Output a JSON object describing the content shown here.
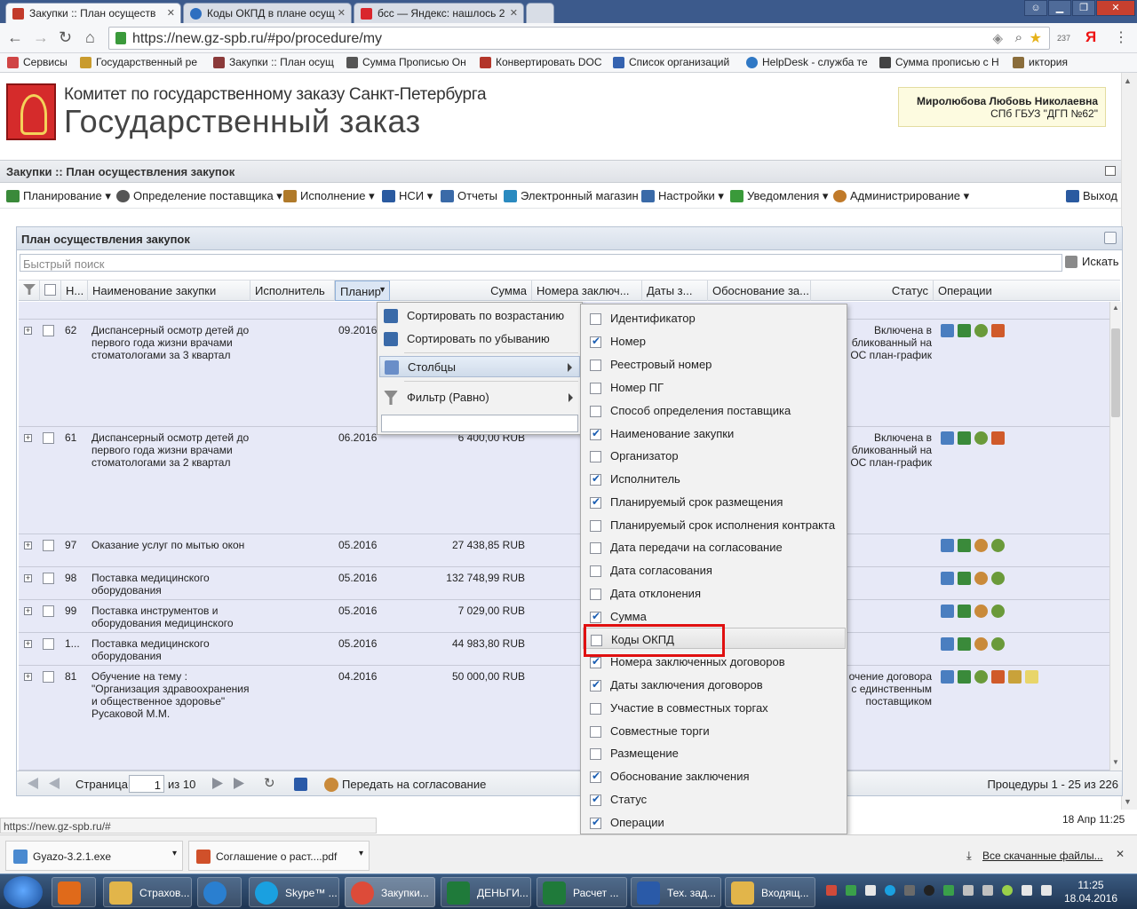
{
  "browser": {
    "tabs": [
      {
        "label": "Закупки :: План осуществ",
        "color": "#c23a2a"
      },
      {
        "label": "Коды ОКПД в плане осущ",
        "color": "#2e6fc0"
      },
      {
        "label": "бсс — Яндекс: нашлось 2",
        "color": "#d9262c"
      }
    ],
    "url": "https://new.gz-spb.ru/#po/procedure/my",
    "badge": "237",
    "bookmarks": [
      {
        "label": "Сервисы",
        "color": "#d04545"
      },
      {
        "label": "Государственный ре",
        "color": "#c99b2d"
      },
      {
        "label": "Закупки :: План осущ",
        "color": "#8b3a3a"
      },
      {
        "label": "Сумма Прописью Он",
        "color": "#555555"
      },
      {
        "label": "Конвертировать DOC",
        "color": "#b3362a"
      },
      {
        "label": "Список организаций",
        "color": "#3563b0"
      },
      {
        "label": "HelpDesk - служба те",
        "color": "#2f78c5"
      },
      {
        "label": "Сумма прописью с Н",
        "color": "#444444"
      },
      {
        "label": "иктория",
        "color": "#8a6d3b"
      }
    ],
    "status_url": "https://new.gz-spb.ru/#",
    "time_inpage": "18 Апр 11:25"
  },
  "site": {
    "subtitle": "Комитет по государственному заказу Санкт-Петербурга",
    "title": "Государственный заказ",
    "user_name": "Миролюбова Любовь Николаевна",
    "user_org": "СПб ГБУЗ \"ДГП №62\""
  },
  "app": {
    "title": "Закупки :: План осуществления закупок",
    "menu": [
      {
        "label": "Планирование",
        "color": "#3a8a3a"
      },
      {
        "label": "Определение поставщика",
        "color": "#555555"
      },
      {
        "label": "Исполнение",
        "color": "#b07a2a"
      },
      {
        "label": "НСИ",
        "color": "#2a5aa0"
      },
      {
        "label": "Отчеты",
        "color": "#3a6aa8"
      },
      {
        "label": "Электронный магазин",
        "color": "#2a8ac0"
      },
      {
        "label": "Настройки",
        "color": "#3a6aa8"
      },
      {
        "label": "Уведомления",
        "color": "#3a9a3a"
      },
      {
        "label": "Администрирование",
        "color": "#c07a2a"
      }
    ],
    "logout": "Выход"
  },
  "panel": {
    "title": "План осуществления закупок",
    "search_placeholder": "Быстрый поиск",
    "search_button": "Искать",
    "columns": {
      "num": "Н...",
      "name": "Наименование закупки",
      "executor": "Исполнитель",
      "plan": "Планир",
      "sum": "Сумма",
      "contracts": "Номера заключ...",
      "dates": "Даты з...",
      "justification": "Обоснование за...",
      "status": "Статус",
      "ops": "Операции"
    },
    "rows": [
      {
        "num": "62",
        "name": "Диспансерный осмотр детей до первого года жизни врачами стоматологами за 3 квартал",
        "date": "09.2016",
        "sum": "",
        "status": "Включена в бликованный на ОС план-график"
      },
      {
        "num": "61",
        "name": "Диспансерный осмотр детей до первого года жизни врачами стоматологами за 2 квартал",
        "date": "06.2016",
        "sum": "6 400,00 RUB",
        "status": "Включена в бликованный на ОС план-график"
      },
      {
        "num": "97",
        "name": "Оказание услуг по мытью окон",
        "date": "05.2016",
        "sum": "27 438,85 RUB",
        "status": ""
      },
      {
        "num": "98",
        "name": "Поставка медицинского оборудования",
        "date": "05.2016",
        "sum": "132 748,99 RUB",
        "status": ""
      },
      {
        "num": "99",
        "name": "Поставка инструментов и оборудования медицинского",
        "date": "05.2016",
        "sum": "7 029,00 RUB",
        "status": ""
      },
      {
        "num": "1...",
        "name": "Поставка медицинского оборудования",
        "date": "05.2016",
        "sum": "44 983,80 RUB",
        "status": ""
      },
      {
        "num": "81",
        "name": "Обучение на тему : \"Организация здравоохранения и общественное здоровье\" Русаковой М.М.",
        "date": "04.2016",
        "sum": "50 000,00 RUB",
        "status": "очение договора с единственным поставщиком"
      }
    ],
    "pager": {
      "page_label": "Страница",
      "page": "1",
      "of": "из 10",
      "send": "Передать на согласование",
      "summary": "Процедуры 1 - 25 из 226"
    }
  },
  "context_menu": {
    "sort_asc": "Сортировать по возрастанию",
    "sort_desc": "Сортировать по убыванию",
    "columns": "Столбцы",
    "filter": "Фильтр (Равно)"
  },
  "columns_menu": [
    {
      "label": "Идентификатор",
      "checked": false
    },
    {
      "label": "Номер",
      "checked": true
    },
    {
      "label": "Реестровый номер",
      "checked": false
    },
    {
      "label": "Номер ПГ",
      "checked": false
    },
    {
      "label": "Способ определения поставщика",
      "checked": false
    },
    {
      "label": "Наименование закупки",
      "checked": true
    },
    {
      "label": "Организатор",
      "checked": false
    },
    {
      "label": "Исполнитель",
      "checked": true
    },
    {
      "label": "Планируемый срок размещения",
      "checked": true
    },
    {
      "label": "Планируемый срок исполнения контракта",
      "checked": false
    },
    {
      "label": "Дата передачи на согласование",
      "checked": false
    },
    {
      "label": "Дата согласования",
      "checked": false
    },
    {
      "label": "Дата отклонения",
      "checked": false
    },
    {
      "label": "Сумма",
      "checked": true
    },
    {
      "label": "Коды ОКПД",
      "checked": false
    },
    {
      "label": "Номера заключенных договоров",
      "checked": true
    },
    {
      "label": "Даты заключения договоров",
      "checked": true
    },
    {
      "label": "Участие в совместных торгах",
      "checked": false
    },
    {
      "label": "Совместные торги",
      "checked": false
    },
    {
      "label": "Размещение",
      "checked": false
    },
    {
      "label": "Обоснование заключения",
      "checked": true
    },
    {
      "label": "Статус",
      "checked": true
    },
    {
      "label": "Операции",
      "checked": true
    }
  ],
  "downloads": {
    "items": [
      "Gyazo-3.2.1.exe",
      "Соглашение о раст....pdf"
    ],
    "all": "Все скачанные файлы..."
  },
  "taskbar": {
    "items": [
      {
        "label": "",
        "color": "#e06a1a"
      },
      {
        "label": "Страхов...",
        "color": "#e2b54a"
      },
      {
        "label": "",
        "color": "#2a7fd0"
      },
      {
        "label": "Skype™ ...",
        "color": "#1aa0e0"
      },
      {
        "label": "Закупки...",
        "color": "#dd4b39"
      },
      {
        "label": "ДЕНЬГИ...",
        "color": "#1f7a3a"
      },
      {
        "label": "Расчет ...",
        "color": "#1f7a3a"
      },
      {
        "label": "Тех. зад...",
        "color": "#2a5aa8"
      },
      {
        "label": "Входящ...",
        "color": "#e2b54a"
      }
    ],
    "time": "11:25",
    "date": "18.04.2016"
  }
}
